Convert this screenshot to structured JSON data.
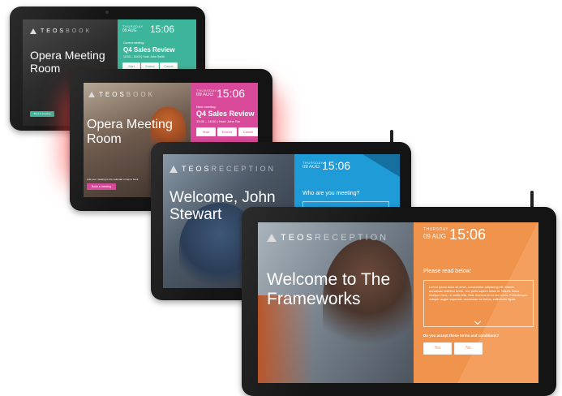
{
  "devices": {
    "green": {
      "accent": "#3db59a",
      "brand": {
        "strong": "TEOS",
        "light": "BOOK"
      },
      "clock": {
        "day": "THURSDAY",
        "date": "09 AUG",
        "time": "15:06"
      },
      "room": "Opera Meeting Room",
      "meeting": {
        "label": "Current meeting:",
        "title": "Q4 Sales Review",
        "when": "15:30 – 16:00 | Host: John Smith"
      },
      "buttons": [
        "Start",
        "Extend",
        "Cancel"
      ],
      "cta": "Book a meeting"
    },
    "pink": {
      "accent": "#d84a99",
      "brand": {
        "strong": "TEOS",
        "light": "BOOK"
      },
      "clock": {
        "day": "THURSDAY",
        "date": "09 AUG",
        "time": "15:06"
      },
      "room": "Opera Meeting Room",
      "meeting": {
        "label": "Next meeting:",
        "title": "Q4 Sales Review",
        "when": "15:30 – 16:00 | Host: John Sm"
      },
      "buttons": [
        "Start",
        "Extend",
        "Cancel"
      ],
      "footer_hint": "Add your meeting to the calendar or tap to book",
      "cta": "Book a meeting"
    },
    "blue": {
      "accent": "#1f9bd7",
      "brand": {
        "strong": "TEOS",
        "light": "RECEPTION"
      },
      "clock": {
        "day": "THURSDAY",
        "date": "09 AUG",
        "time": "15:06"
      },
      "welcome": "Welcome, John Stewart",
      "question": "Who are you meeting?"
    },
    "orange": {
      "accent": "#f0934c",
      "brand": {
        "strong": "TEOS",
        "light": "RECEPTION"
      },
      "clock": {
        "day": "THURSDAY",
        "date": "09 AUG",
        "time": "15:06"
      },
      "welcome": "Welcome to The Frameworks",
      "read_label": "Please read below:",
      "terms": "Lorem ipsum dolor sit amet, consectetur adipiscing elit. Mauris accumsan eleifend lorem, non porta sapien fortus id. Mauris fortus tristique risus, ut mollis felis. Duis rhoncus id mi nec ruens. Pellentesque semper augue vulputate, accumsan vel fortus, sollicitudin ligula.",
      "accept_question": "Do you accept these terms and conditions?",
      "yes": "Yes",
      "no": "No"
    }
  }
}
